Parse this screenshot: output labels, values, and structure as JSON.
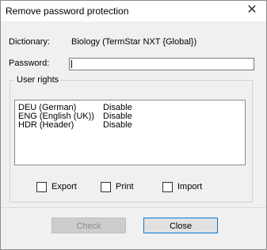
{
  "window": {
    "title": "Remove password protection"
  },
  "dictionary": {
    "label": "Dictionary:",
    "value": "Biology (TermStar NXT {Global})"
  },
  "password": {
    "label": "Password:",
    "value": ""
  },
  "user_rights": {
    "legend": "User rights",
    "rows": [
      {
        "language": "DEU (German)",
        "status": "Disable"
      },
      {
        "language": "ENG (English (UK))",
        "status": "Disable"
      },
      {
        "language": "HDR (Header)",
        "status": "Disable"
      }
    ],
    "checkboxes": [
      {
        "label": "Export",
        "checked": false
      },
      {
        "label": "Print",
        "checked": false
      },
      {
        "label": "Import",
        "checked": false
      }
    ]
  },
  "buttons": {
    "check": "Check",
    "close": "Close"
  },
  "icons": {
    "close": "close-icon"
  },
  "colors": {
    "close_button_border": "#0078d7",
    "disabled_button": "#cccccc"
  }
}
